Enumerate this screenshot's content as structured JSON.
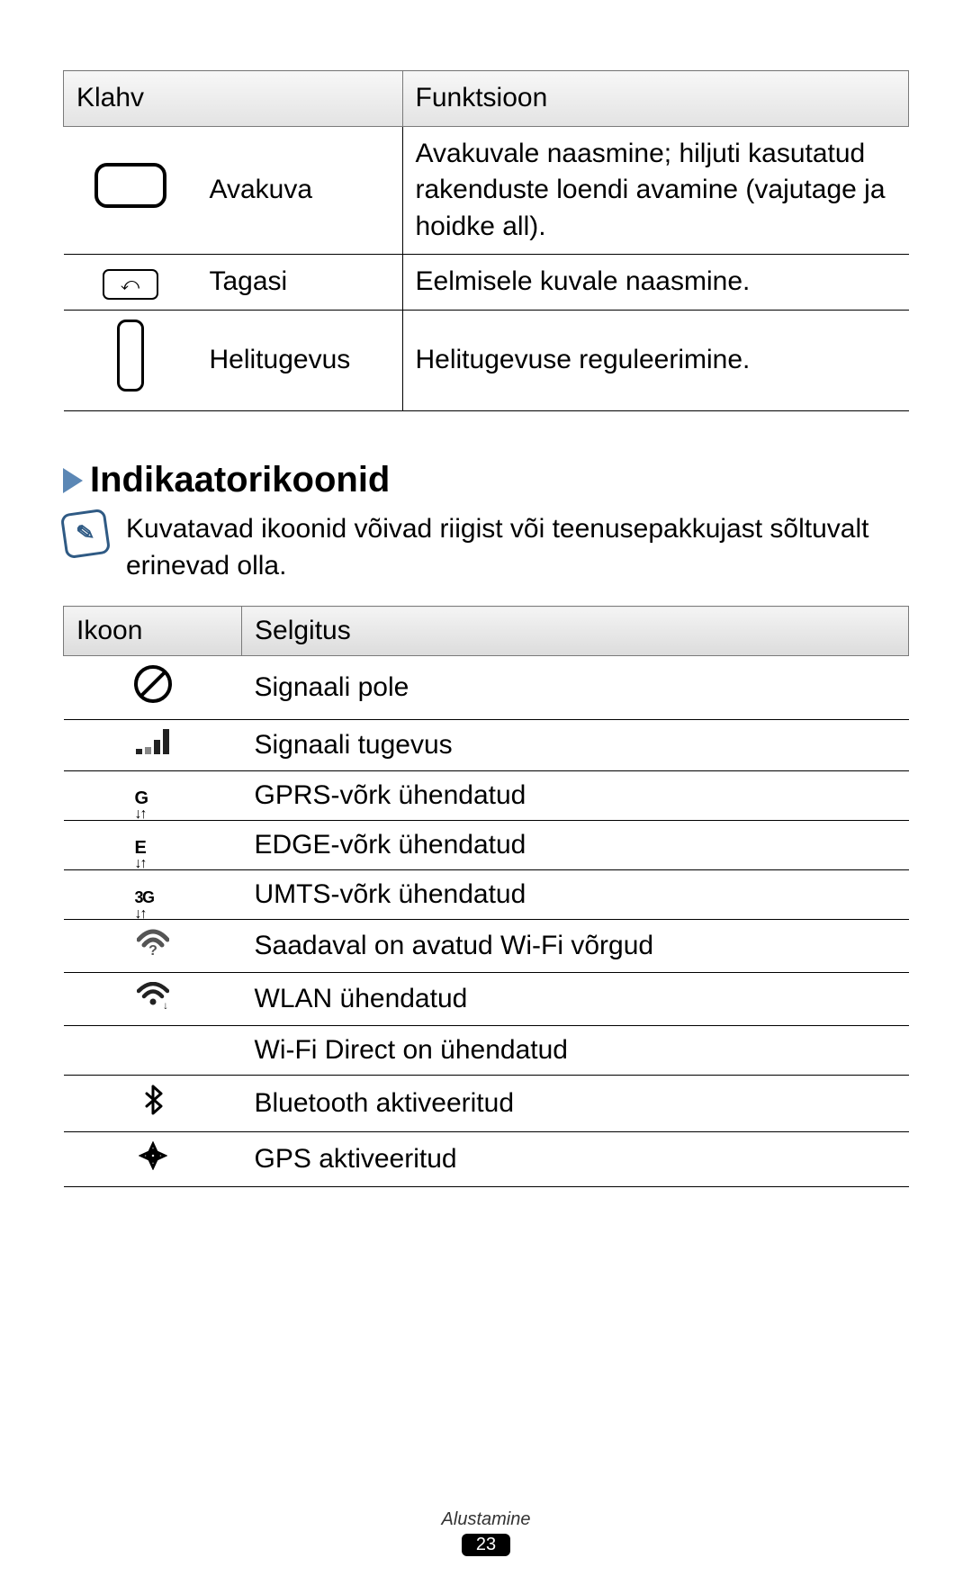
{
  "table1": {
    "headers": {
      "key": "Klahv",
      "func": "Funktsioon"
    },
    "rows": [
      {
        "icon": "home",
        "name": "Avakuva",
        "desc": "Avakuvale naasmine; hiljuti kasutatud rakenduste loendi avamine (vajutage ja hoidke all)."
      },
      {
        "icon": "back",
        "name": "Tagasi",
        "desc": "Eelmisele kuvale naasmine."
      },
      {
        "icon": "volume",
        "name": "Helitugevus",
        "desc": "Helitugevuse reguleerimine."
      }
    ]
  },
  "section": {
    "title": "Indikaatorikoonid",
    "note": "Kuvatavad ikoonid võivad riigist või teenusepakkujast sõltuvalt erinevad olla."
  },
  "table2": {
    "headers": {
      "icon": "Ikoon",
      "desc": "Selgitus"
    },
    "rows": [
      {
        "icon": "no-signal",
        "desc": "Signaali pole"
      },
      {
        "icon": "signal",
        "desc": "Signaali tugevus"
      },
      {
        "icon": "gprs",
        "desc": "GPRS-võrk ühendatud"
      },
      {
        "icon": "edge",
        "desc": "EDGE-võrk ühendatud"
      },
      {
        "icon": "umts",
        "desc": "UMTS-võrk ühendatud"
      },
      {
        "icon": "wifi-available",
        "desc": "Saadaval on avatud Wi-Fi võrgud"
      },
      {
        "icon": "wlan",
        "desc": "WLAN ühendatud"
      },
      {
        "icon": "wifi-direct",
        "desc": "Wi-Fi Direct on ühendatud"
      },
      {
        "icon": "bluetooth",
        "desc": "Bluetooth aktiveeritud"
      },
      {
        "icon": "gps",
        "desc": "GPS aktiveeritud"
      }
    ]
  },
  "footer": {
    "section": "Alustamine",
    "page": "23"
  }
}
